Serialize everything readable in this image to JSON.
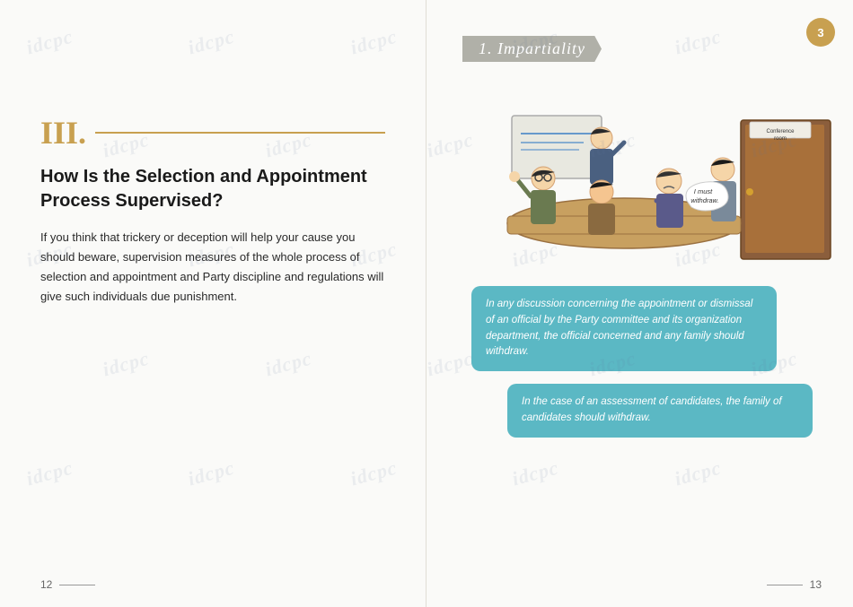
{
  "watermarks": [
    "idcpc",
    "idcpc",
    "idcpc",
    "idcpc",
    "idcpc",
    "idcpc",
    "idcpc",
    "idcpc",
    "idcpc",
    "idcpc",
    "idcpc",
    "idcpc",
    "idcpc",
    "idcpc",
    "idcpc",
    "idcpc",
    "idcpc",
    "idcpc",
    "idcpc",
    "idcpc"
  ],
  "left_page": {
    "page_number": "12",
    "roman_numeral": "III.",
    "section_title": "How Is the Selection and Appointment Process Supervised?",
    "section_body": "If you think that trickery or deception will help your cause you should beware, supervision measures of the whole process of selection and appointment and Party discipline and regulations will give such individuals due punishment."
  },
  "right_page": {
    "page_number": "13",
    "page_badge": "3",
    "section_header": "1.  Impartiality",
    "conference_room_label": "Conference room",
    "speech_bubble_character": "I must withdraw.",
    "bubble1": "In any discussion concerning the appointment or dismissal of an official by the Party committee and its organization department, the official concerned and any family should withdraw.",
    "bubble2": "In the case of an assessment of candidates, the family of candidates should withdraw."
  }
}
